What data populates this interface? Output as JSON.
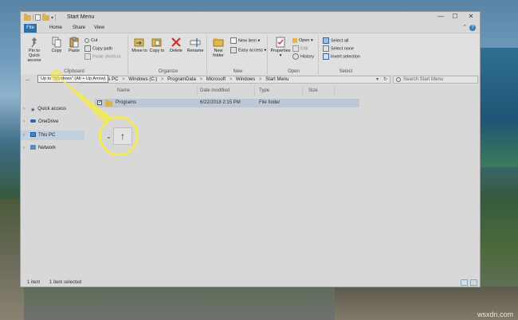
{
  "window": {
    "title": "Start Menu",
    "controls": {
      "minimize": "—",
      "maximize": "☐",
      "close": "✕"
    }
  },
  "ribbon_tabs": [
    "File",
    "Home",
    "Share",
    "View"
  ],
  "ribbon": {
    "clipboard": {
      "label": "Clipboard",
      "pin": "Pin to Quick access",
      "copy": "Copy",
      "paste": "Paste",
      "cut": "Cut",
      "copy_path": "Copy path",
      "paste_shortcut": "Paste shortcut"
    },
    "organize": {
      "label": "Organize",
      "move_to": "Move to",
      "copy_to": "Copy to",
      "delete": "Delete",
      "rename": "Rename"
    },
    "new": {
      "label": "New",
      "new_folder": "New folder",
      "new_item": "New item",
      "easy_access": "Easy access"
    },
    "open": {
      "label": "Open",
      "properties": "Properties",
      "open": "Open",
      "edit": "Edit",
      "history": "History"
    },
    "select": {
      "label": "Select",
      "select_all": "Select all",
      "select_none": "Select none",
      "invert": "Invert selection"
    }
  },
  "address": {
    "crumbs": [
      "This PC",
      "Windows (C:)",
      "ProgramData",
      "Microsoft",
      "Windows",
      "Start Menu"
    ],
    "separator": ">",
    "search_placeholder": "Search Start Menu"
  },
  "tooltip": "Up to \"Windows\" (Alt + Up Arrow)",
  "nav": {
    "items": [
      "Quick access",
      "OneDrive",
      "This PC",
      "Network"
    ]
  },
  "columns": {
    "name": "Name",
    "date": "Date modified",
    "type": "Type",
    "size": "Size"
  },
  "files": [
    {
      "name": "Programs",
      "date": "6/22/2018 2:15 PM",
      "type": "File folder",
      "size": ""
    }
  ],
  "status": {
    "count": "1 item",
    "selected": "1 item selected"
  },
  "zoom": {
    "glyph": "↑"
  },
  "watermark": "wsxdn.com",
  "colors": {
    "accent": "#2d6fa8",
    "highlight": "#f2ea56",
    "selection": "#bcc8d4"
  }
}
